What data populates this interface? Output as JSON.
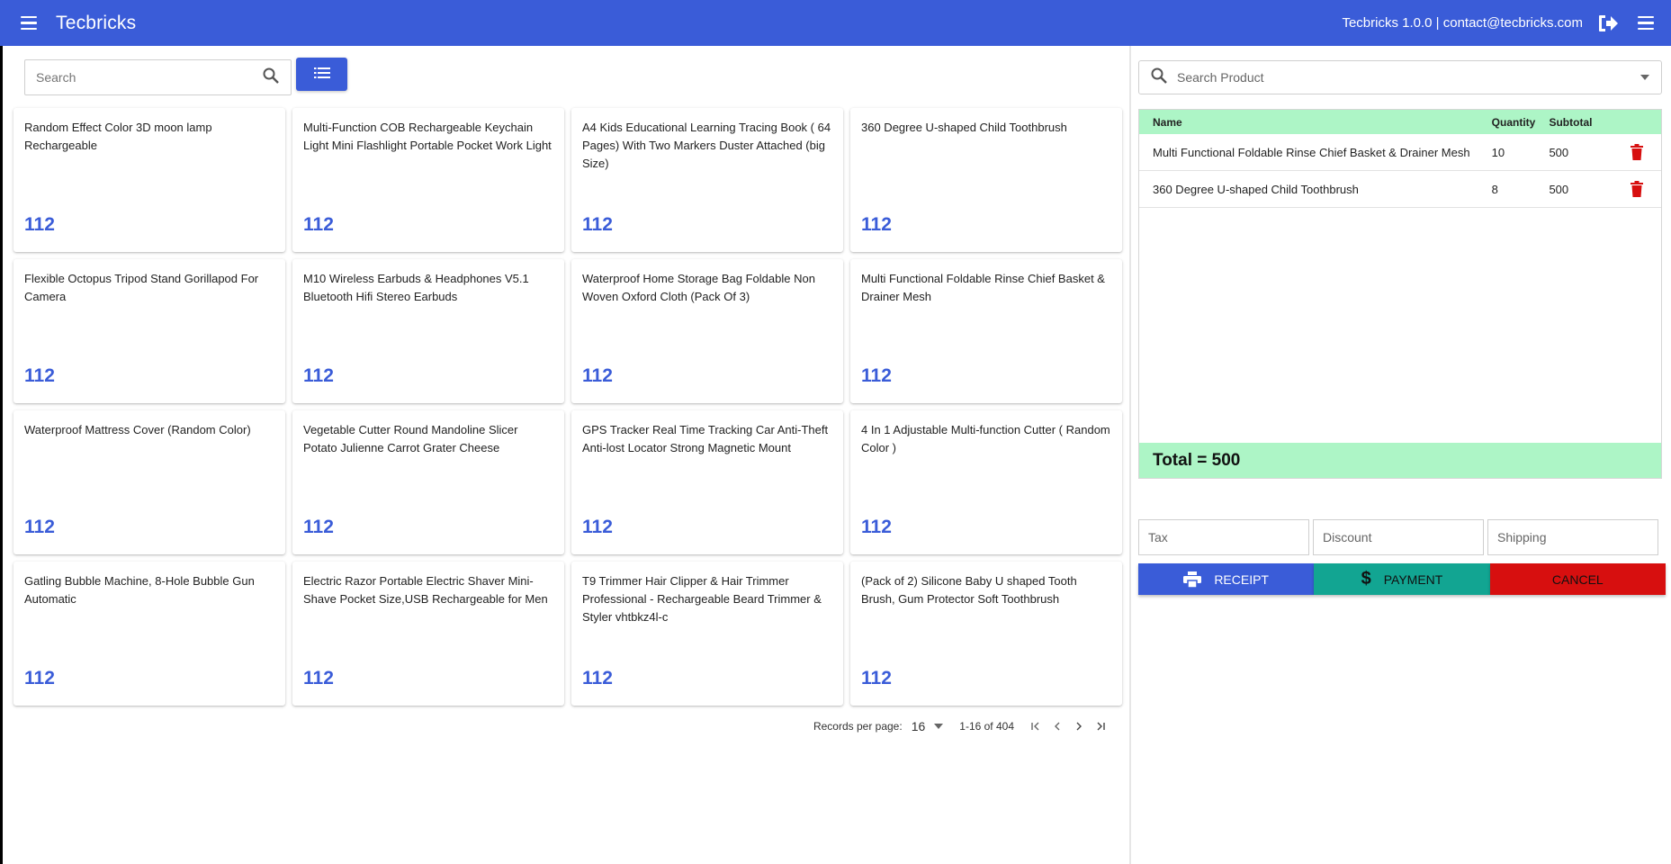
{
  "header": {
    "title": "Tecbricks",
    "info": "Tecbricks 1.0.0 | contact@tecbricks.com"
  },
  "search": {
    "placeholder": "Search"
  },
  "products": [
    {
      "name": "Random Effect Color 3D moon lamp Rechargeable",
      "price": "112"
    },
    {
      "name": "Multi-Function COB Rechargeable Keychain Light Mini Flashlight Portable Pocket Work Light",
      "price": "112"
    },
    {
      "name": "A4 Kids Educational Learning Tracing Book ( 64 Pages) With Two Markers Duster Attached (big Size)",
      "price": "112"
    },
    {
      "name": "360 Degree U-shaped Child Toothbrush",
      "price": "112"
    },
    {
      "name": "Flexible Octopus Tripod Stand Gorillapod For Camera",
      "price": "112"
    },
    {
      "name": "M10 Wireless Earbuds & Headphones V5.1 Bluetooth Hifi Stereo Earbuds",
      "price": "112"
    },
    {
      "name": "Waterproof Home Storage Bag Foldable Non Woven Oxford Cloth (Pack Of 3)",
      "price": "112"
    },
    {
      "name": "Multi Functional Foldable Rinse Chief Basket & Drainer Mesh",
      "price": "112"
    },
    {
      "name": "Waterproof Mattress Cover (Random Color)",
      "price": "112"
    },
    {
      "name": "Vegetable Cutter Round Mandoline Slicer Potato Julienne Carrot Grater Cheese",
      "price": "112"
    },
    {
      "name": "GPS Tracker Real Time Tracking Car Anti-Theft Anti-lost Locator Strong Magnetic Mount",
      "price": "112"
    },
    {
      "name": "4 In 1 Adjustable Multi-function Cutter ( Random Color )",
      "price": "112"
    },
    {
      "name": "Gatling Bubble Machine, 8-Hole Bubble Gun Automatic",
      "price": "112"
    },
    {
      "name": "Electric Razor Portable Electric Shaver Mini-Shave Pocket Size,USB Rechargeable for Men",
      "price": "112"
    },
    {
      "name": "T9 Trimmer Hair Clipper & Hair Trimmer Professional - Rechargeable Beard Trimmer & Styler vhtbkz4l-c",
      "price": "112"
    },
    {
      "name": "(Pack of 2) Silicone Baby U shaped Tooth Brush, Gum Protector Soft Toothbrush",
      "price": "112"
    }
  ],
  "pagination": {
    "records_label": "Records per page:",
    "per_page": "16",
    "range": "1-16 of 404"
  },
  "cart": {
    "search_placeholder": "Search Product",
    "columns": {
      "name": "Name",
      "quantity": "Quantity",
      "subtotal": "Subtotal"
    },
    "items": [
      {
        "name": "Multi Functional Foldable Rinse Chief Basket & Drainer Mesh",
        "quantity": "10",
        "subtotal": "500"
      },
      {
        "name": "360 Degree U-shaped Child Toothbrush",
        "quantity": "8",
        "subtotal": "500"
      }
    ],
    "total": "Total = 500",
    "tax_placeholder": "Tax",
    "discount_placeholder": "Discount",
    "shipping_placeholder": "Shipping"
  },
  "actions": {
    "receipt": "Receipt",
    "payment": "Payment",
    "cancel": "Cancel"
  },
  "colors": {
    "primary": "#3A5CD8",
    "cart_header": "#ADF5C6",
    "payment": "#12A592",
    "cancel": "#D70F0F",
    "delete_icon": "#D70F0F"
  },
  "icons": [
    "menu-icon",
    "search-icon",
    "list-icon",
    "logout-icon",
    "dropdown-icon",
    "delete-icon",
    "printer-icon",
    "dollar-icon",
    "first-page-icon",
    "prev-page-icon",
    "next-page-icon",
    "last-page-icon"
  ]
}
